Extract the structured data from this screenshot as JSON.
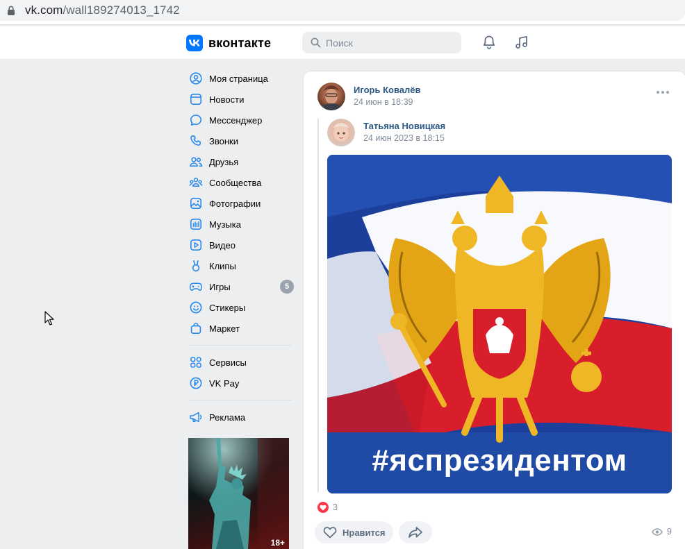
{
  "browser": {
    "url_host": "vk.com",
    "url_path": "/wall189274013_1742"
  },
  "header": {
    "logo_text": "вконтакте",
    "search_placeholder": "Поиск",
    "icons": [
      "bell-icon",
      "music-icon"
    ]
  },
  "sidebar": {
    "items": [
      {
        "label": "Моя страница",
        "icon": "user-circle-icon"
      },
      {
        "label": "Новости",
        "icon": "news-icon"
      },
      {
        "label": "Мессенджер",
        "icon": "message-icon"
      },
      {
        "label": "Звонки",
        "icon": "phone-icon"
      },
      {
        "label": "Друзья",
        "icon": "friends-icon"
      },
      {
        "label": "Сообщества",
        "icon": "communities-icon"
      },
      {
        "label": "Фотографии",
        "icon": "photo-icon"
      },
      {
        "label": "Музыка",
        "icon": "music-icon"
      },
      {
        "label": "Видео",
        "icon": "video-icon"
      },
      {
        "label": "Клипы",
        "icon": "clips-icon"
      },
      {
        "label": "Игры",
        "icon": "games-icon",
        "badge": "5"
      },
      {
        "label": "Стикеры",
        "icon": "smile-icon"
      },
      {
        "label": "Маркет",
        "icon": "market-bag-icon"
      }
    ],
    "items2": [
      {
        "label": "Сервисы",
        "icon": "services-icon"
      },
      {
        "label": "VK Pay",
        "icon": "ruble-icon"
      }
    ],
    "items3": [
      {
        "label": "Реклама",
        "icon": "megaphone-icon"
      }
    ],
    "ad_badge": "18+"
  },
  "post": {
    "author": "Игорь Ковалёв",
    "date": "24 июн в 18:39",
    "repost": {
      "author": "Татьяна Новицкая",
      "date": "24 июн 2023 в 18:15",
      "image_caption": "#яспрезидентом"
    },
    "likes_count": "3",
    "like_button": "Нравится",
    "views_count": "9"
  },
  "colors": {
    "vk_blue": "#0077ff",
    "link": "#2a5885",
    "like_red": "#ff3347"
  }
}
